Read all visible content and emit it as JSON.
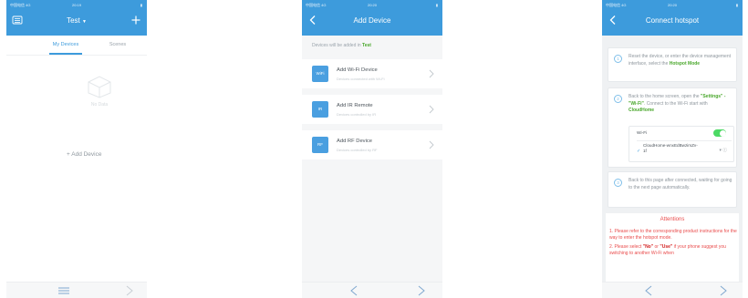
{
  "status": {
    "carrier": "中国电信 4G",
    "time_1": "20:19",
    "time_2": "20:20",
    "time_3": "20:20"
  },
  "screen1": {
    "title": "Test",
    "tabs": [
      {
        "label": "My Devices",
        "active": true
      },
      {
        "label": "Scenes",
        "active": false
      }
    ],
    "empty_text": "No Data",
    "add_device_label": "+ Add Device"
  },
  "screen2": {
    "title": "Add Device",
    "subtitle_prefix": "Devices will be added in",
    "subtitle_home": "Test",
    "items": [
      {
        "icon": "WiFi",
        "title": "Add Wi-Fi Device",
        "subtitle": "Devices connected with Wi-Fi"
      },
      {
        "icon": "IR",
        "title": "Add IR Remote",
        "subtitle": "Devices controlled by IR"
      },
      {
        "icon": "RF",
        "title": "Add RF Device",
        "subtitle": "Devices controlled by RF"
      }
    ]
  },
  "screen3": {
    "title": "Connect hotspot",
    "steps": [
      {
        "number": "1",
        "text": "Reset the device, or enter the device management interface, select the",
        "highlight": "Hotspot Mode"
      },
      {
        "number": "2",
        "text_a": "Back to the home screen, open the",
        "hl_1": "\"Settings\" - \"Wi-Fi\"",
        "text_b": ". Connect to the Wi-Fi start with",
        "hl_2": "CloudHome",
        "wifi_label": "Wi-Fi",
        "network_name": "CloudHome-wnxEdBwzimZv-1f"
      },
      {
        "number": "3",
        "text": "Back to this page after connected, waiting for going to the next page automatically."
      }
    ],
    "attention_title": "Attentions",
    "attention_1": "1. Please refer to the corresponding product instructions for the way to enter the hotspot mode.",
    "attention_2_a": "2. Please select",
    "attention_2_no": "\"No\"",
    "attention_2_or": "or",
    "attention_2_use": "\"Use\"",
    "attention_2_b": "if your phone suggest you switching to another Wi-Fi when"
  },
  "colors": {
    "brand_blue": "#3d9bdc",
    "accent_green": "#49a72b",
    "attention_red": "#e94b4b",
    "toggle_on": "#4cd964"
  }
}
